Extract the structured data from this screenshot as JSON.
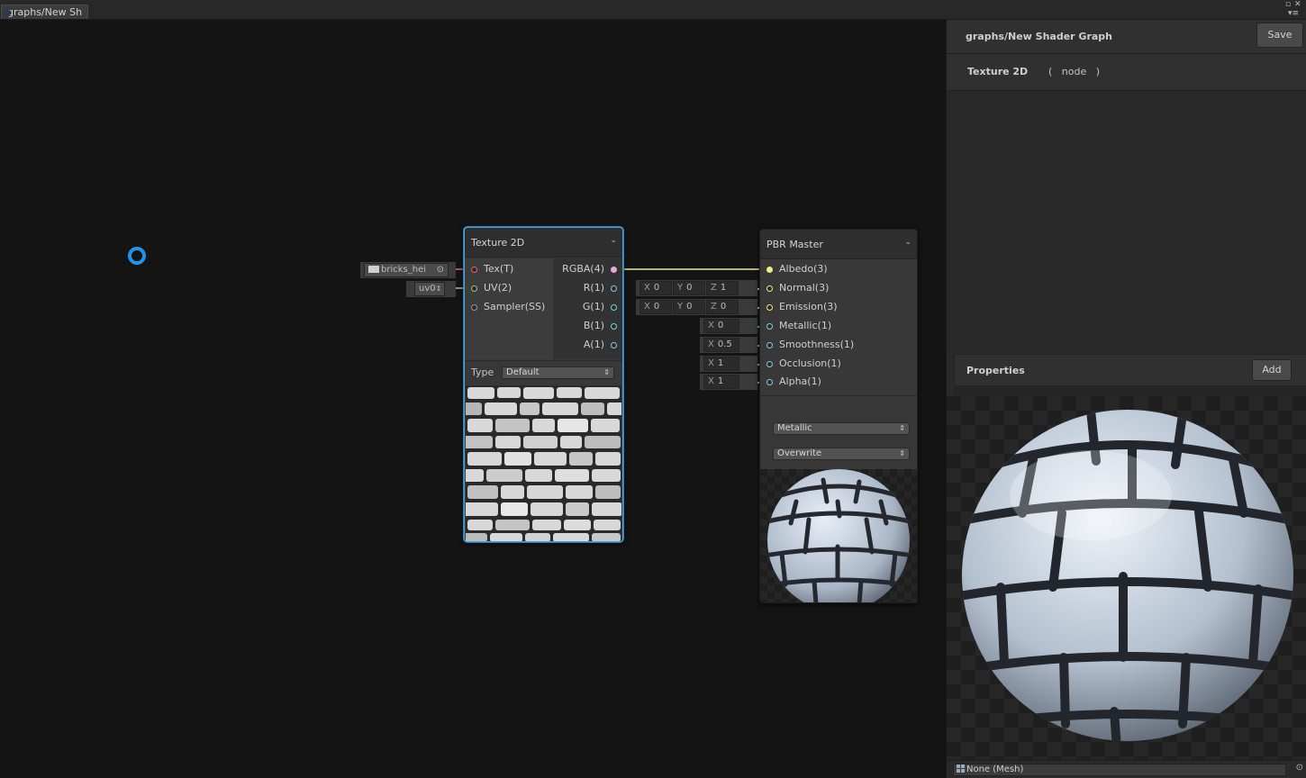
{
  "window": {
    "tab_label": "graphs/New Sh",
    "maximize_glyph": "▫",
    "close_glyph": "✕",
    "menu_glyph": "▾≡"
  },
  "texture_node": {
    "title": "Texture 2D",
    "inputs": [
      {
        "label": "Tex(T)",
        "color": "#e06666"
      },
      {
        "label": "UV(2)",
        "color": "#8bd36b"
      },
      {
        "label": "Sampler(SS)",
        "color": "#9a9a9a"
      }
    ],
    "outputs": [
      {
        "label": "RGBA(4)",
        "color": "#e8a8d8"
      },
      {
        "label": "R(1)",
        "color": "#80d0e8"
      },
      {
        "label": "G(1)",
        "color": "#80d0e8"
      },
      {
        "label": "B(1)",
        "color": "#80d0e8"
      },
      {
        "label": "A(1)",
        "color": "#80d0e8"
      }
    ],
    "tex_field": "bricks_hei",
    "tex_field_glyph": "⊙",
    "uv_field": "uv0",
    "type_label": "Type",
    "type_value": "Default"
  },
  "pbr_node": {
    "title": "PBR Master",
    "inputs": [
      {
        "label": "Albedo(3)",
        "color": "#ecec8a"
      },
      {
        "label": "Normal(3)",
        "color": "#ecec8a"
      },
      {
        "label": "Emission(3)",
        "color": "#ecec8a"
      },
      {
        "label": "Metallic(1)",
        "color": "#80d0e8"
      },
      {
        "label": "Smoothness(1)",
        "color": "#80d0e8"
      },
      {
        "label": "Occlusion(1)",
        "color": "#80d0e8"
      },
      {
        "label": "Alpha(1)",
        "color": "#80d0e8"
      }
    ],
    "normal_field": {
      "x": "0",
      "y": "0",
      "z": "1"
    },
    "emission_field": {
      "x": "0",
      "y": "0",
      "z": "0"
    },
    "metallic_value": "0",
    "smoothness_value": "0.5",
    "occlusion_value": "1",
    "alpha_value": "1",
    "workflow_value": "Metallic",
    "blend_value": "Overwrite"
  },
  "inspector": {
    "graph_title": "graphs/New Shader Graph",
    "save_label": "Save",
    "node_name": "Texture 2D",
    "node_kind_open": "(",
    "node_kind": "node",
    "node_kind_close": ")",
    "properties_title": "Properties",
    "add_label": "Add",
    "mesh_field": "None (Mesh)",
    "mesh_target_glyph": "⊙"
  },
  "axis_labels": {
    "x": "X",
    "y": "Y",
    "z": "Z"
  },
  "colors": {
    "accent_blue": "#2592e8",
    "selection": "#4aa3d8",
    "wire_rgba": "#ecec9a"
  }
}
